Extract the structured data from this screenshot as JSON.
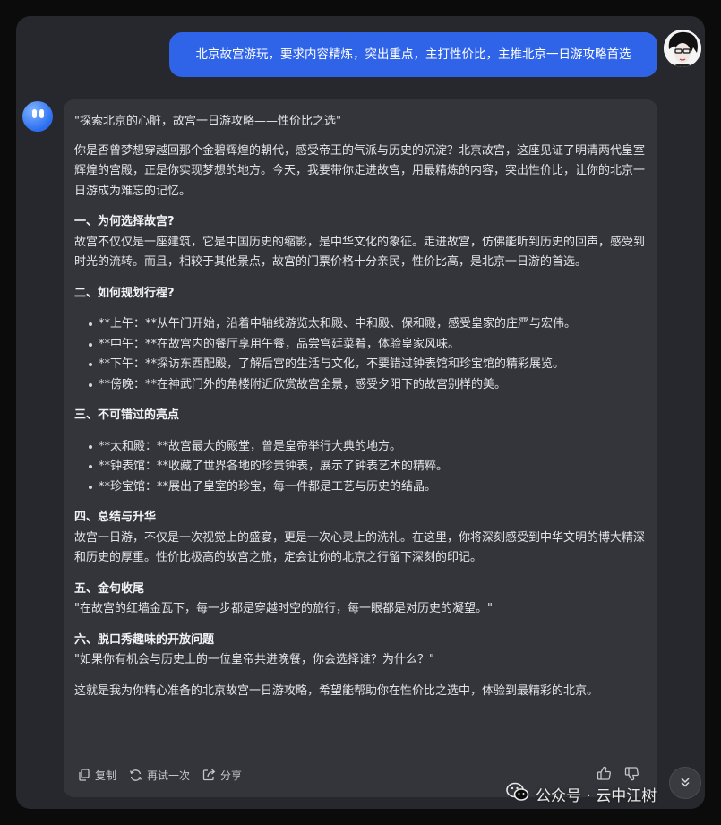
{
  "conversation": {
    "user_message": "北京故宫游玩，要求内容精炼，突出重点，主打性价比，主推北京一日游攻略首选",
    "reply": {
      "title_line": "\"探索北京的心脏，故宫一日游攻略——性价比之选\"",
      "intro": "你是否曾梦想穿越回那个金碧辉煌的朝代，感受帝王的气派与历史的沉淀？北京故宫，这座见证了明清两代皇室辉煌的宫殿，正是你实现梦想的地方。今天，我要带你走进故宫，用最精炼的内容，突出性价比，让你的北京一日游成为难忘的记忆。",
      "sections": {
        "s1_heading": "一、为何选择故宫?",
        "s1_text": "故宫不仅仅是一座建筑，它是中国历史的缩影，是中华文化的象征。走进故宫，仿佛能听到历史的回声，感受到时光的流转。而且，相较于其他景点，故宫的门票价格十分亲民，性价比高，是北京一日游的首选。",
        "s2_heading": "二、如何规划行程?",
        "s2_items": [
          "**上午：**从午门开始，沿着中轴线游览太和殿、中和殿、保和殿，感受皇家的庄严与宏伟。",
          "**中午：**在故宫内的餐厅享用午餐，品尝宫廷菜肴，体验皇家风味。",
          "**下午：**探访东西配殿，了解后宫的生活与文化，不要错过钟表馆和珍宝馆的精彩展览。",
          "**傍晚：**在神武门外的角楼附近欣赏故宫全景，感受夕阳下的故宫别样的美。"
        ],
        "s3_heading": "三、不可错过的亮点",
        "s3_items": [
          "**太和殿：**故宫最大的殿堂，曾是皇帝举行大典的地方。",
          "**钟表馆：**收藏了世界各地的珍贵钟表，展示了钟表艺术的精粹。",
          "**珍宝馆：**展出了皇室的珍宝，每一件都是工艺与历史的结晶。"
        ],
        "s4_heading": "四、总结与升华",
        "s4_text": "故宫一日游，不仅是一次视觉上的盛宴，更是一次心灵上的洗礼。在这里，你将深刻感受到中华文明的博大精深和历史的厚重。性价比极高的故宫之旅，定会让你的北京之行留下深刻的印记。",
        "s5_heading": "五、金句收尾",
        "s5_text": "\"在故宫的红墙金瓦下，每一步都是穿越时空的旅行，每一眼都是对历史的凝望。\"",
        "s6_heading": "六、脱口秀趣味的开放问题",
        "s6_text": "\"如果你有机会与历史上的一位皇帝共进晚餐，你会选择谁？为什么？\""
      },
      "closing": "这就是我为你精心准备的北京故宫一日游攻略，希望能帮助你在性价比之选中，体验到最精彩的北京。"
    },
    "actions": {
      "copy_label": "复制",
      "retry_label": "再试一次",
      "share_label": "分享"
    }
  },
  "watermark": {
    "text": "公众号 · 云中江树"
  },
  "colors": {
    "window_bg": "#27282d",
    "user_bubble": "#2f63e8",
    "reply_bg": "#34353a",
    "text": "#e3e4e8"
  },
  "icons": [
    "user-avatar",
    "bot-avatar",
    "copy-icon",
    "retry-icon",
    "share-icon",
    "thumbs-up-icon",
    "thumbs-down-icon",
    "scroll-down-icon",
    "wechat-icon"
  ]
}
